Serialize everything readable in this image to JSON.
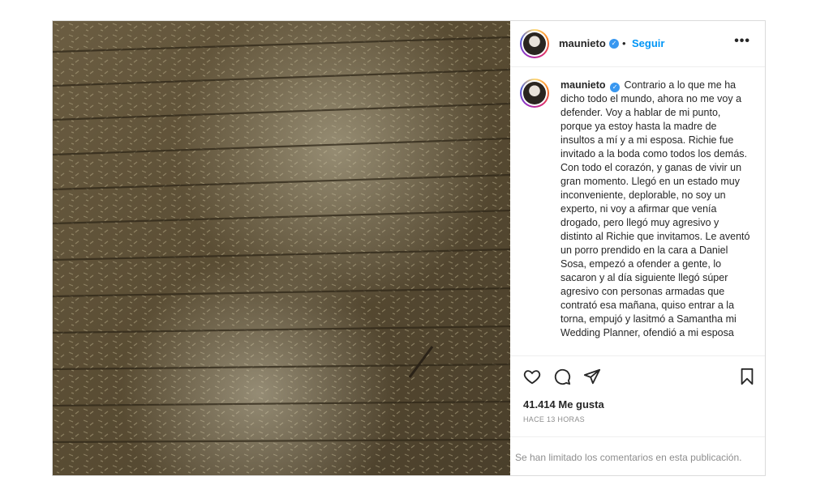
{
  "post": {
    "username": "maunieto",
    "separator": "•",
    "follow_label": "Seguir",
    "more_label": "•••",
    "caption_text": "Contrario a lo que me ha dicho todo el mundo, ahora no me voy a defender. Voy a hablar de mi punto, porque ya estoy hasta la madre de insultos a mí y a mi esposa. Richie fue invitado a la boda como todos los demás. Con todo el corazón, y ganas de vivir un gran momento. Llegó en un estado muy inconveniente, deplorable, no soy un experto, ni voy a afirmar que venía drogado, pero llegó muy agresivo y distinto al Richie que invitamos. Le aventó un porro prendido en la cara a Daniel Sosa, empezó a ofender a gente, lo sacaron y al día siguiente llegó súper agresivo con personas armadas que contrató esa mañana, quiso entrar a la torna, empujó y lasitmó a Samantha mi Wedding Planner, ofendió a mi esposa",
    "likes": "41.414 Me gusta",
    "time": "HACE 13 HORAS",
    "comments_notice": "Se han limitado los comentarios en esta publicación.",
    "icons": {
      "verified": "verified-badge-icon",
      "like": "heart-icon",
      "comment": "comment-bubble-icon",
      "share": "paper-plane-icon",
      "save": "bookmark-icon"
    },
    "colors": {
      "link": "#0095f6",
      "verified": "#3897f0",
      "muted": "#8e8e8e",
      "border": "#dbdbdb"
    }
  }
}
